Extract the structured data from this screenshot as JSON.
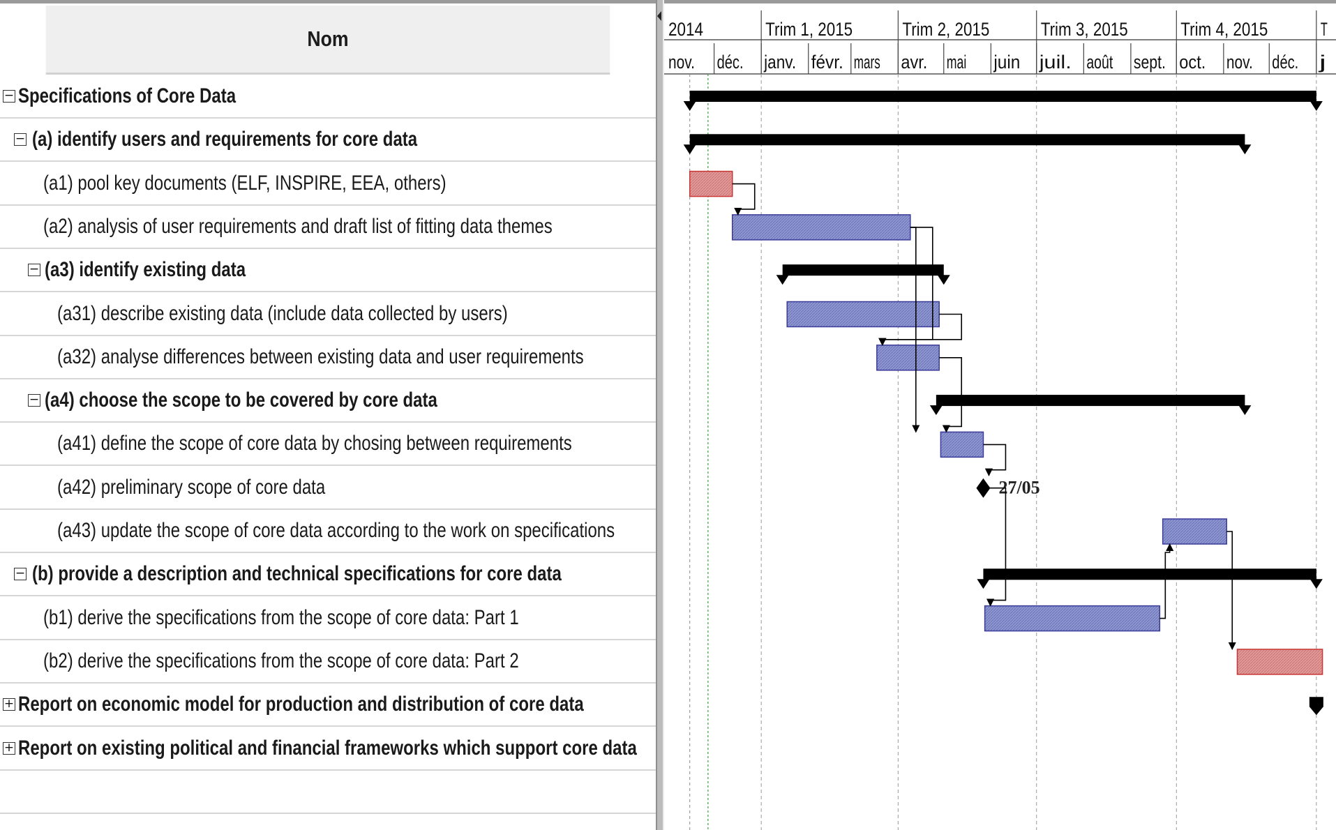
{
  "task_table": {
    "header": "Nom",
    "rows": [
      {
        "label": "Specifications of Core Data",
        "summary": true,
        "level": 0,
        "toggle": "minus"
      },
      {
        "label": "(a) identify users and requirements for core data",
        "summary": true,
        "level": 1,
        "toggle": "minus"
      },
      {
        "label": "(a1) pool key documents (ELF, INSPIRE, EEA, others)",
        "summary": false,
        "level": 2
      },
      {
        "label": "(a2) analysis of user requirements and draft list of fitting data themes",
        "summary": false,
        "level": 2
      },
      {
        "label": "(a3) identify existing data",
        "summary": true,
        "level": 2,
        "toggle": "minus"
      },
      {
        "label": "(a31) describe existing data (include data collected by users)",
        "summary": false,
        "level": 3
      },
      {
        "label": "(a32) analyse differences between existing data and user requirements",
        "summary": false,
        "level": 3
      },
      {
        "label": "(a4) choose the scope to be covered by core data",
        "summary": true,
        "level": 2,
        "toggle": "minus"
      },
      {
        "label": "(a41) define the scope of core data by chosing between requirements",
        "summary": false,
        "level": 3
      },
      {
        "label": "(a42) preliminary scope of core data",
        "summary": false,
        "level": 3
      },
      {
        "label": "(a43) update the scope of core data according to the work on specifications",
        "summary": false,
        "level": 3
      },
      {
        "label": "(b) provide a description and technical specifications for core data",
        "summary": true,
        "level": 1,
        "toggle": "minus"
      },
      {
        "label": "(b1) derive the specifications from the scope of core data: Part 1",
        "summary": false,
        "level": 2
      },
      {
        "label": "(b2) derive the specifications from the scope of core data: Part 2",
        "summary": false,
        "level": 2
      },
      {
        "label": "Report on economic model for production and distribution of core data",
        "summary": true,
        "level": 0,
        "toggle": "plus"
      },
      {
        "label": "Report on existing political and financial frameworks which support core data",
        "summary": true,
        "level": 0,
        "toggle": "plus"
      },
      {
        "label": "",
        "summary": false,
        "level": 0
      },
      {
        "label": "",
        "summary": false,
        "level": 0
      }
    ]
  },
  "timescale": {
    "quarters": [
      "2014",
      "Trim 1, 2015",
      "Trim 2, 2015",
      "Trim 3, 2015",
      "Trim 4, 2015",
      "T"
    ],
    "months": [
      "nov.",
      "déc.",
      "janv.",
      "févr.",
      "mars",
      "avr.",
      "mai",
      "juin",
      "juil.",
      "août",
      "sept.",
      "oct.",
      "nov.",
      "déc.",
      "j"
    ]
  },
  "gantt_bars": [
    {
      "row": 0,
      "kind": "summary",
      "start": "2014-11-15",
      "end": "2016-01-01"
    },
    {
      "row": 1,
      "kind": "summary",
      "start": "2014-11-15",
      "end": "2015-11-15"
    },
    {
      "row": 2,
      "kind": "critical",
      "start": "2014-11-15",
      "end": "2014-12-13"
    },
    {
      "row": 3,
      "kind": "task",
      "start": "2014-12-13",
      "end": "2015-04-09"
    },
    {
      "row": 4,
      "kind": "summary",
      "start": "2015-01-15",
      "end": "2015-05-01"
    },
    {
      "row": 5,
      "kind": "task",
      "start": "2015-01-18",
      "end": "2015-04-28"
    },
    {
      "row": 6,
      "kind": "task",
      "start": "2015-03-18",
      "end": "2015-04-28"
    },
    {
      "row": 7,
      "kind": "summary",
      "start": "2015-04-26",
      "end": "2015-11-15"
    },
    {
      "row": 8,
      "kind": "task",
      "start": "2015-04-29",
      "end": "2015-05-27"
    },
    {
      "row": 9,
      "kind": "milestone",
      "date": "2015-05-27",
      "label": "27/05"
    },
    {
      "row": 10,
      "kind": "task",
      "start": "2015-09-22",
      "end": "2015-11-03"
    },
    {
      "row": 11,
      "kind": "summary",
      "start": "2015-05-27",
      "end": "2016-01-01"
    },
    {
      "row": 12,
      "kind": "task",
      "start": "2015-05-28",
      "end": "2015-09-20"
    },
    {
      "row": 13,
      "kind": "critical",
      "start": "2015-11-10",
      "end": "2016-01-05"
    },
    {
      "row": 14,
      "kind": "summary-end",
      "date": "2016-01-01"
    }
  ],
  "links": [
    {
      "from": 2,
      "to": 3
    },
    {
      "from": 3,
      "to": 6
    },
    {
      "from": 3,
      "to": 8
    },
    {
      "from": 5,
      "to": 6
    },
    {
      "from": 6,
      "to": 8
    },
    {
      "from": 8,
      "to": 9
    },
    {
      "from": 9,
      "to": 12
    },
    {
      "from": 12,
      "to": 10
    },
    {
      "from": 10,
      "to": 13
    }
  ],
  "status_date": "2014-11-27",
  "colors": {
    "task_fill": "#8f97cf",
    "task_border": "#3a3a9a",
    "critical_fill": "#e09a9a",
    "critical_border": "#c83636",
    "summary": "#000000",
    "grid": "#9a9a9a",
    "status_line": "#3aa03a"
  }
}
